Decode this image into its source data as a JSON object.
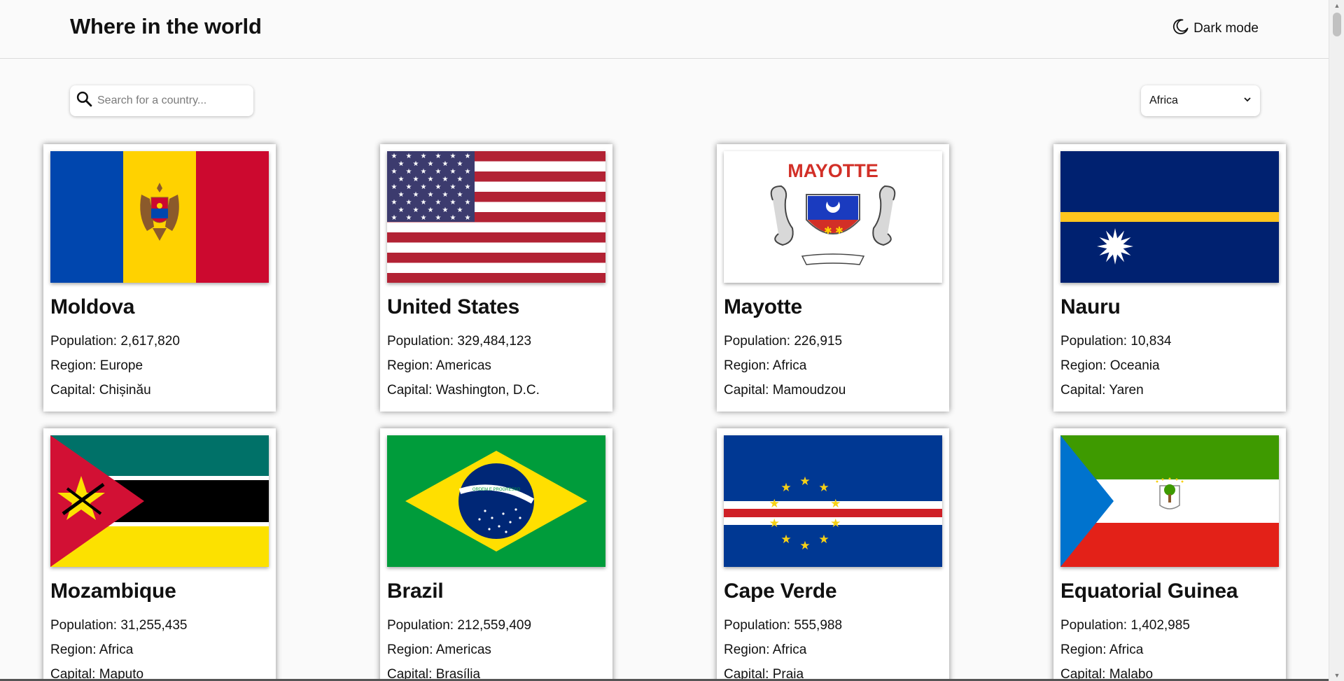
{
  "header": {
    "title": "Where in the world",
    "mode_label": "Dark mode"
  },
  "search": {
    "placeholder": "Search for a country...",
    "value": ""
  },
  "filter": {
    "selected": "Africa"
  },
  "labels": {
    "population": "Population: ",
    "region": "Region: ",
    "capital": "Capital: "
  },
  "countries": [
    {
      "name": "Moldova",
      "population": "2,617,820",
      "region": "Europe",
      "capital": "Chișinău",
      "flag_text": ""
    },
    {
      "name": "United States",
      "population": "329,484,123",
      "region": "Americas",
      "capital": "Washington, D.C.",
      "flag_text": ""
    },
    {
      "name": "Mayotte",
      "population": "226,915",
      "region": "Africa",
      "capital": "Mamoudzou",
      "flag_text": "MAYOTTE"
    },
    {
      "name": "Nauru",
      "population": "10,834",
      "region": "Oceania",
      "capital": "Yaren",
      "flag_text": ""
    },
    {
      "name": "Mozambique",
      "population": "31,255,435",
      "region": "Africa",
      "capital": "Maputo",
      "flag_text": ""
    },
    {
      "name": "Brazil",
      "population": "212,559,409",
      "region": "Americas",
      "capital": "Brasília",
      "flag_text": "ORDEM E PROGRESSO"
    },
    {
      "name": "Cape Verde",
      "population": "555,988",
      "region": "Africa",
      "capital": "Praia",
      "flag_text": ""
    },
    {
      "name": "Equatorial Guinea",
      "population": "1,402,985",
      "region": "Africa",
      "capital": "Malabo",
      "flag_text": ""
    }
  ],
  "colors": {
    "background": "#fafafa",
    "card": "#ffffff",
    "text": "#111111"
  }
}
